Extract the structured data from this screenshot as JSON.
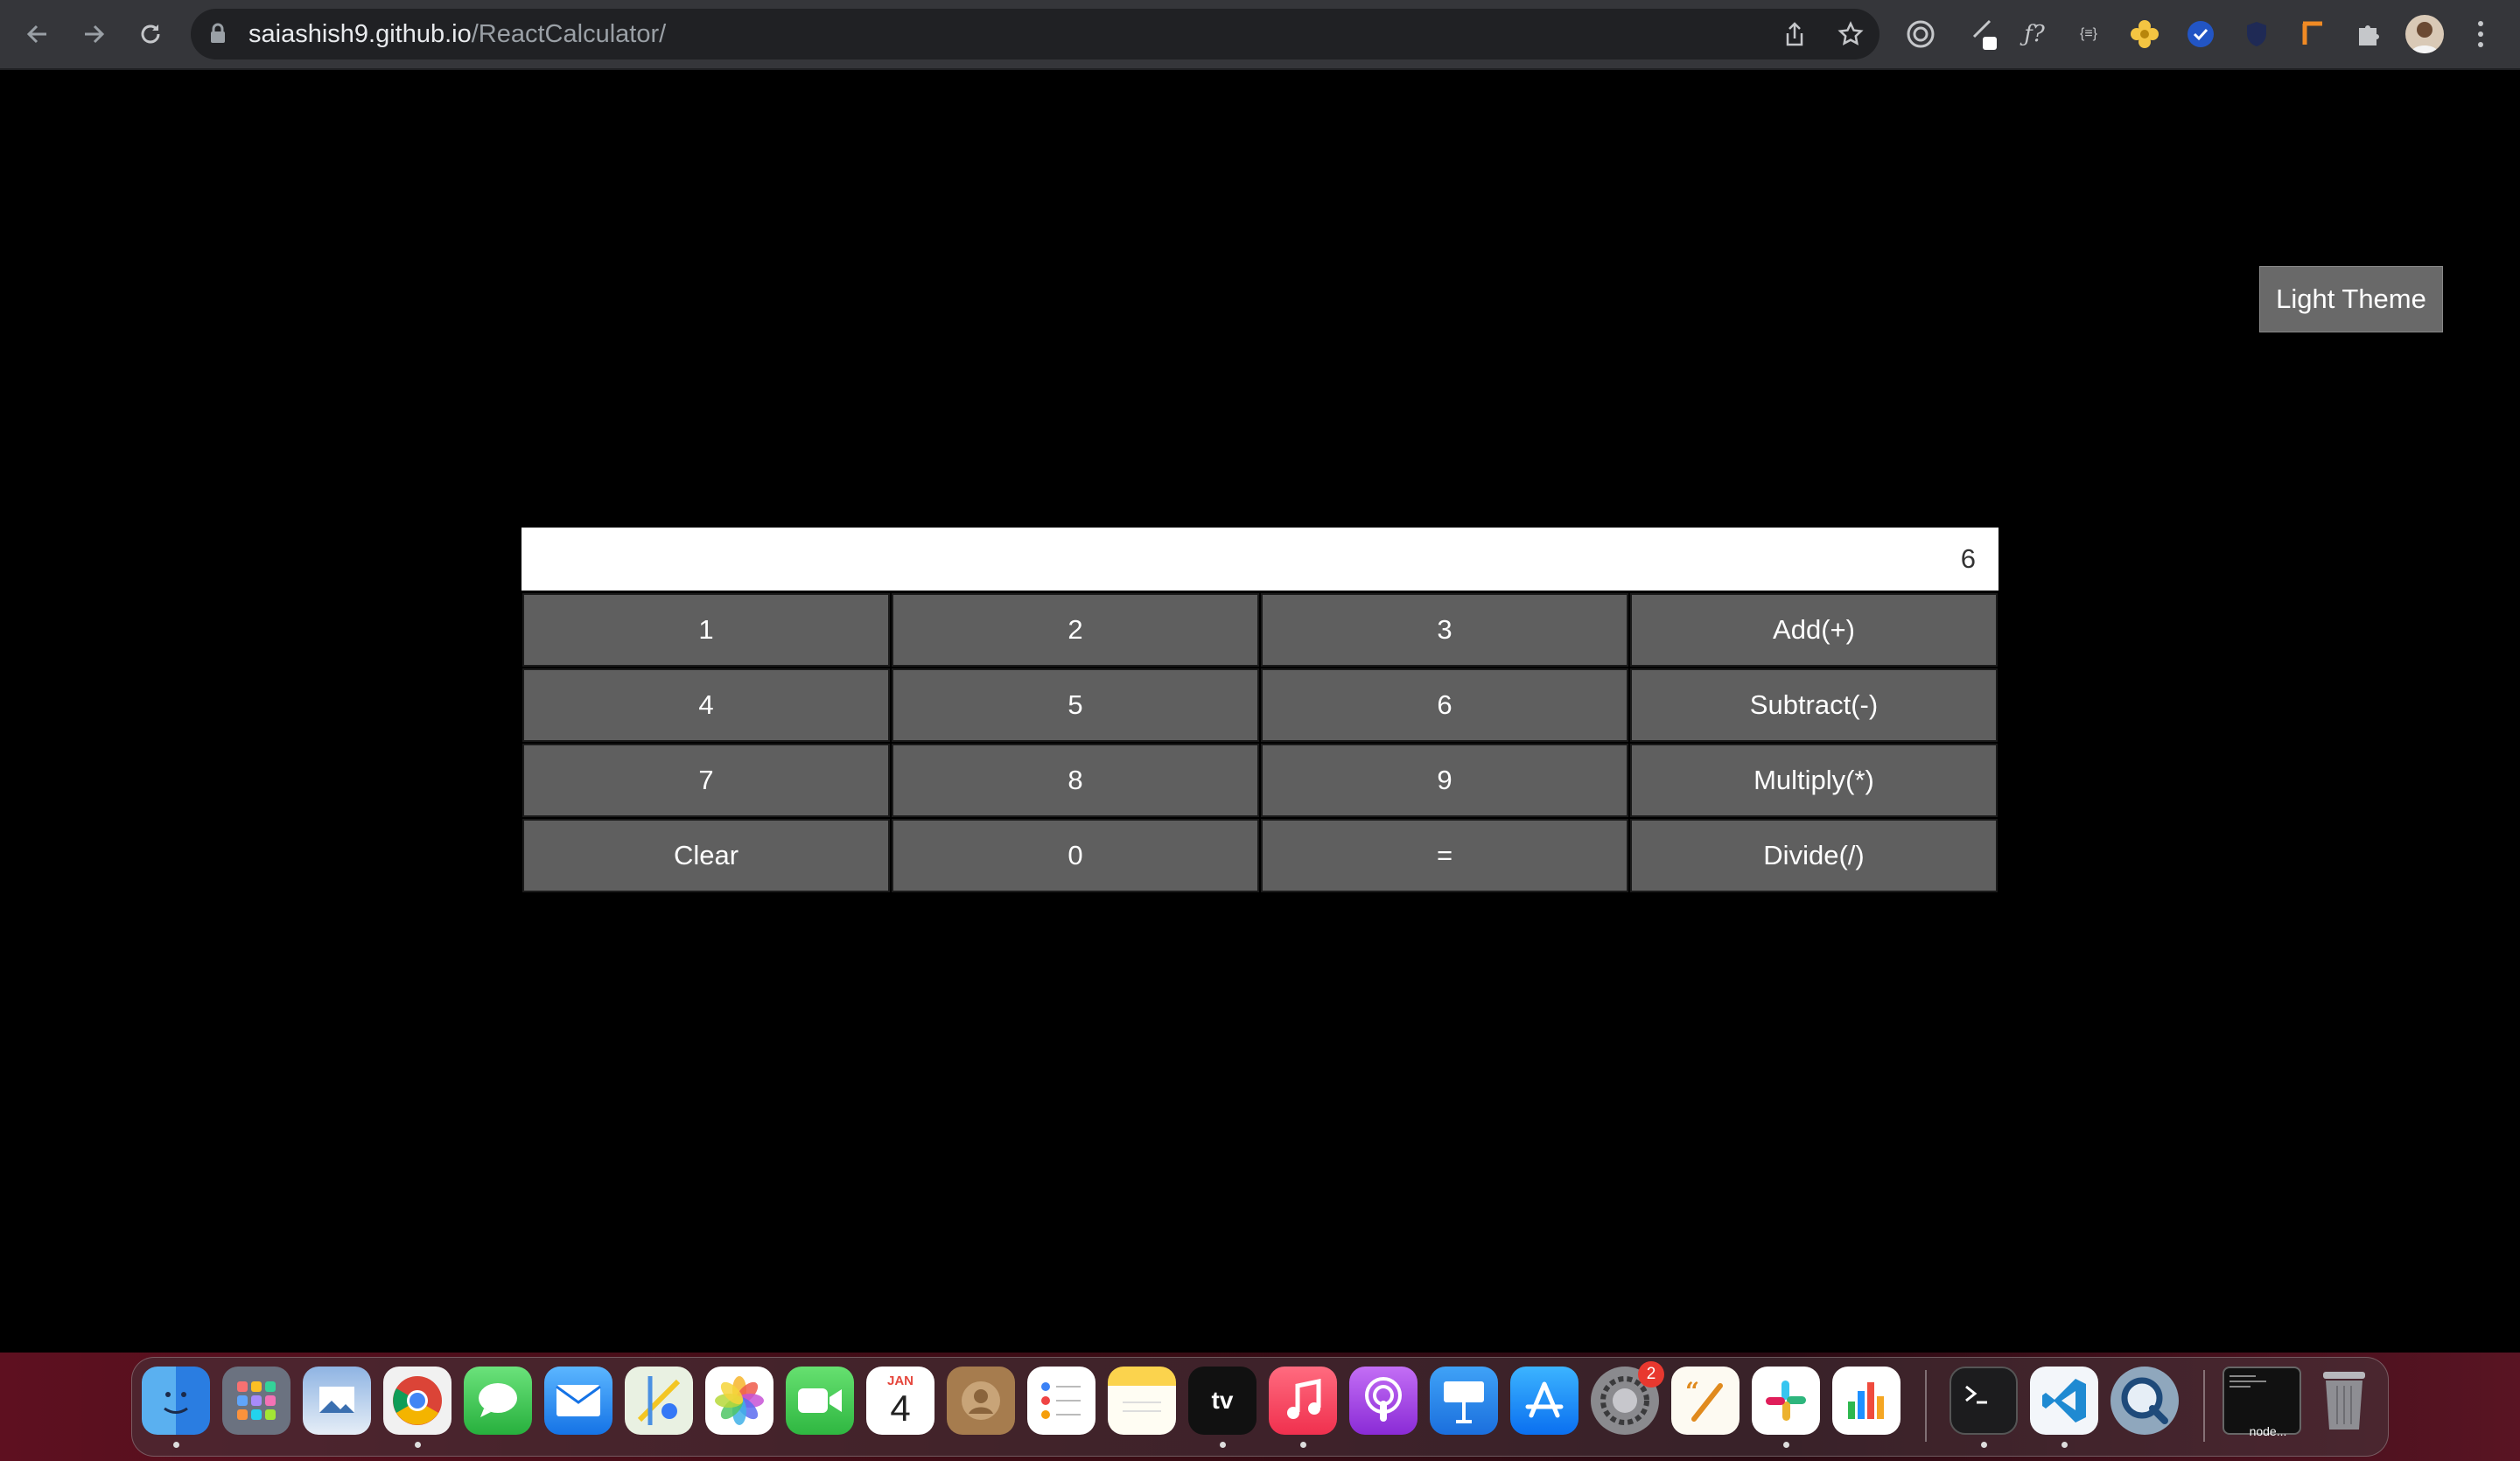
{
  "browser": {
    "url_host": "saiashish9.github.io",
    "url_path": "/ReactCalculator/"
  },
  "page": {
    "theme_button": "Light Theme",
    "display_value": "6",
    "keys": [
      "1",
      "2",
      "3",
      "Add(+)",
      "4",
      "5",
      "6",
      "Subtract(-)",
      "7",
      "8",
      "9",
      "Multiply(*)",
      "Clear",
      "0",
      "=",
      "Divide(/)"
    ]
  },
  "dock": {
    "calendar_month": "JAN",
    "calendar_day": "4",
    "tv_label": "tv",
    "settings_badge": "2",
    "node_label": "node..."
  },
  "colors": {
    "page_background": "#000000",
    "key_background": "#5f5f5f",
    "display_background": "#ffffff",
    "theme_button_background": "#696969",
    "toolbar_background": "#35363a"
  }
}
